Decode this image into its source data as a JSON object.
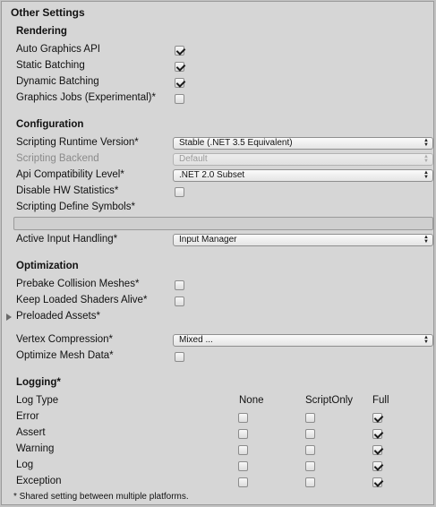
{
  "header": {
    "title": "Other Settings"
  },
  "rendering": {
    "title": "Rendering",
    "auto_graphics_api": {
      "label": "Auto Graphics API",
      "checked": true
    },
    "static_batching": {
      "label": "Static Batching",
      "checked": true
    },
    "dynamic_batching": {
      "label": "Dynamic Batching",
      "checked": true
    },
    "graphics_jobs": {
      "label": "Graphics Jobs (Experimental)*",
      "checked": false
    }
  },
  "configuration": {
    "title": "Configuration",
    "scripting_runtime": {
      "label": "Scripting Runtime Version*",
      "value": "Stable (.NET 3.5 Equivalent)"
    },
    "scripting_backend": {
      "label": "Scripting Backend",
      "value": "Default"
    },
    "api_compat": {
      "label": "Api Compatibility Level*",
      "value": ".NET 2.0 Subset"
    },
    "disable_hw_stats": {
      "label": "Disable HW Statistics*",
      "checked": false
    },
    "define_symbols": {
      "label": "Scripting Define Symbols*",
      "value": ""
    },
    "active_input": {
      "label": "Active Input Handling*",
      "value": "Input Manager"
    }
  },
  "optimization": {
    "title": "Optimization",
    "prebake": {
      "label": "Prebake Collision Meshes*",
      "checked": false
    },
    "keep_shaders": {
      "label": "Keep Loaded Shaders Alive*",
      "checked": false
    },
    "preloaded_assets": {
      "label": "Preloaded Assets*"
    },
    "vertex_compression": {
      "label": "Vertex Compression*",
      "value": "Mixed ..."
    },
    "optimize_mesh": {
      "label": "Optimize Mesh Data*",
      "checked": false
    }
  },
  "logging": {
    "title": "Logging*",
    "columns": {
      "type": "Log Type",
      "none": "None",
      "script": "ScriptOnly",
      "full": "Full"
    },
    "rows": [
      {
        "label": "Error",
        "selected": "full"
      },
      {
        "label": "Assert",
        "selected": "full"
      },
      {
        "label": "Warning",
        "selected": "full"
      },
      {
        "label": "Log",
        "selected": "full"
      },
      {
        "label": "Exception",
        "selected": "full"
      }
    ]
  },
  "footer": {
    "note": "* Shared setting between multiple platforms."
  },
  "icons": {
    "checkbox": "checkbox",
    "dropdown": "dropdown-arrows-icon",
    "foldout": "foldout-triangle-icon"
  }
}
